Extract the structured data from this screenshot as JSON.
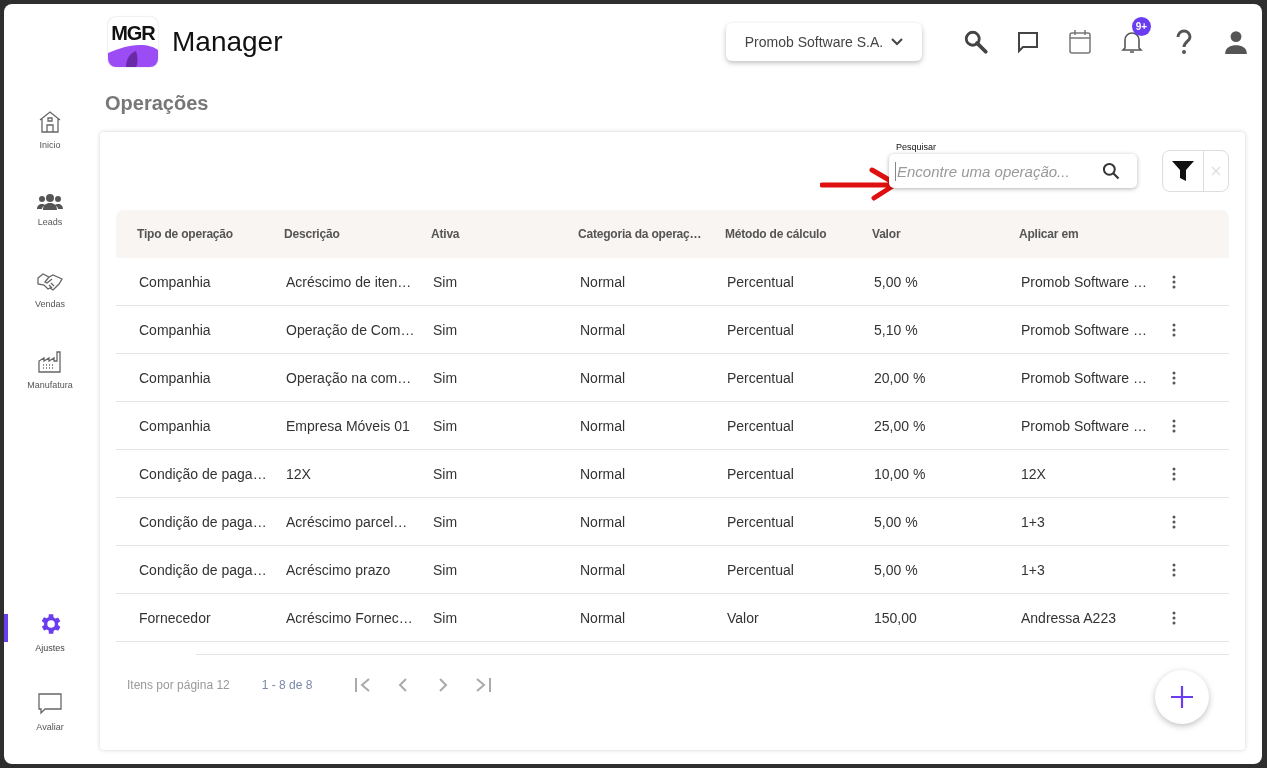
{
  "sidebar": {
    "items": [
      {
        "label": "Inicio",
        "selected": false
      },
      {
        "label": "Leads",
        "selected": false
      },
      {
        "label": "Vendas",
        "selected": false
      },
      {
        "label": "Manufatura",
        "selected": false
      },
      {
        "label": "Ajustes",
        "selected": true
      },
      {
        "label": "Avaliar",
        "selected": false
      }
    ]
  },
  "header": {
    "logo_text": "MGR",
    "app_name": "Manager",
    "company": "Promob Software S.A.",
    "notification_badge": "9+"
  },
  "page_title": "Operações",
  "search": {
    "label": "Pesquisar",
    "placeholder": "Encontre uma operação..."
  },
  "table": {
    "columns": [
      "Tipo de operação",
      "Descrição",
      "Ativa",
      "Categoria da operaç…",
      "Método de cálculo",
      "Valor",
      "Aplicar em"
    ],
    "rows": [
      [
        "Companhia",
        "Acréscimo de iten…",
        "Sim",
        "Normal",
        "Percentual",
        "5,00 %",
        "Promob Software …"
      ],
      [
        "Companhia",
        "Operação de Com…",
        "Sim",
        "Normal",
        "Percentual",
        "5,10 %",
        "Promob Software …"
      ],
      [
        "Companhia",
        "Operação na com…",
        "Sim",
        "Normal",
        "Percentual",
        "20,00 %",
        "Promob Software …"
      ],
      [
        "Companhia",
        "Empresa Móveis 01",
        "Sim",
        "Normal",
        "Percentual",
        "25,00 %",
        "Promob Software …"
      ],
      [
        "Condição de paga…",
        "12X",
        "Sim",
        "Normal",
        "Percentual",
        "10,00 %",
        "12X"
      ],
      [
        "Condição de paga…",
        "Acréscimo parcel…",
        "Sim",
        "Normal",
        "Percentual",
        "5,00 %",
        "1+3"
      ],
      [
        "Condição de paga…",
        "Acréscimo prazo",
        "Sim",
        "Normal",
        "Percentual",
        "5,00 %",
        "1+3"
      ],
      [
        "Fornecedor",
        "Acréscimo Fornec…",
        "Sim",
        "Normal",
        "Valor",
        "150,00",
        "Andressa A223"
      ]
    ]
  },
  "pagination": {
    "items_per_page": "Itens por página 12",
    "range": "1 - 8 de 8"
  }
}
